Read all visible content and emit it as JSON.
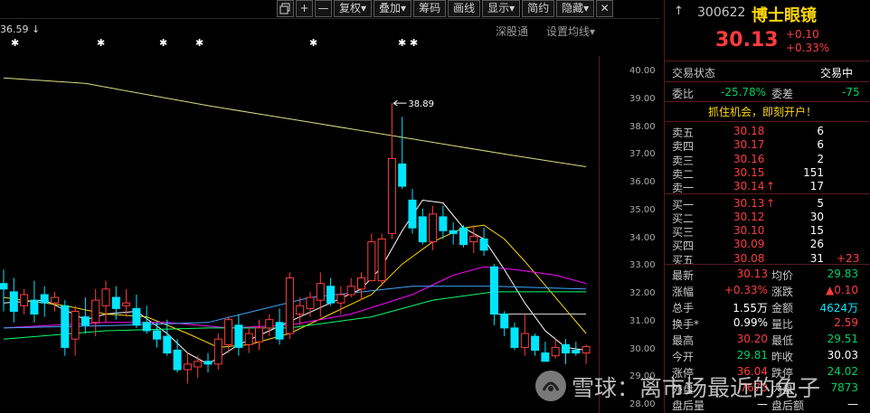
{
  "toolbar": {
    "icons": [
      "restore-icon",
      "plus-icon",
      "minus-icon"
    ],
    "buttons": [
      "复权▾",
      "叠加▾",
      "筹码",
      "画线",
      "显示▾",
      "简约",
      "隐藏▾"
    ],
    "close_icon": "✕"
  },
  "chart_header": {
    "price_hint": "36.59 ↓",
    "sector_link": "深股通",
    "ma_settings": "设置均线▾"
  },
  "chart_data": {
    "type": "candlestick",
    "y_axis_ticks": [
      "40.00",
      "39.00",
      "38.00",
      "37.00",
      "36.00",
      "35.00",
      "34.00",
      "33.00",
      "32.00",
      "31.00",
      "30.00",
      "29.00",
      "28.00"
    ],
    "ylim": [
      28,
      40
    ],
    "high_annotation": "38.89",
    "colors": {
      "up": "#ff3c3c",
      "down": "#00e5ff",
      "ma5": "#ffffff",
      "ma10": "#ffd700",
      "ma20": "#ff00ff",
      "ma60": "#00ff66",
      "ma120": "#3fa6ff",
      "ma250": "#dede80"
    },
    "candles": [
      {
        "o": 32.4,
        "h": 32.9,
        "l": 31.4,
        "c": 32.2
      },
      {
        "o": 32.1,
        "h": 32.6,
        "l": 31.0,
        "c": 31.4
      },
      {
        "o": 31.6,
        "h": 32.2,
        "l": 31.3,
        "c": 32.0
      },
      {
        "o": 31.8,
        "h": 32.5,
        "l": 31.0,
        "c": 31.3
      },
      {
        "o": 32.0,
        "h": 32.3,
        "l": 31.2,
        "c": 31.7
      },
      {
        "o": 31.7,
        "h": 32.1,
        "l": 31.4,
        "c": 31.9
      },
      {
        "o": 31.6,
        "h": 31.8,
        "l": 29.8,
        "c": 30.1
      },
      {
        "o": 30.4,
        "h": 31.6,
        "l": 29.8,
        "c": 31.4
      },
      {
        "o": 31.2,
        "h": 31.9,
        "l": 30.6,
        "c": 30.9
      },
      {
        "o": 31.0,
        "h": 32.2,
        "l": 30.5,
        "c": 31.8
      },
      {
        "o": 31.6,
        "h": 32.5,
        "l": 31.0,
        "c": 32.2
      },
      {
        "o": 31.9,
        "h": 32.3,
        "l": 31.1,
        "c": 31.5
      },
      {
        "o": 31.6,
        "h": 32.2,
        "l": 31.2,
        "c": 31.7
      },
      {
        "o": 31.5,
        "h": 32.0,
        "l": 30.8,
        "c": 30.9
      },
      {
        "o": 31.0,
        "h": 31.6,
        "l": 30.6,
        "c": 30.7
      },
      {
        "o": 30.7,
        "h": 31.0,
        "l": 30.1,
        "c": 30.4
      },
      {
        "o": 30.5,
        "h": 31.1,
        "l": 29.8,
        "c": 29.9
      },
      {
        "o": 30.0,
        "h": 30.4,
        "l": 29.2,
        "c": 29.3
      },
      {
        "o": 29.3,
        "h": 29.9,
        "l": 28.8,
        "c": 29.5
      },
      {
        "o": 29.4,
        "h": 29.8,
        "l": 29.0,
        "c": 29.6
      },
      {
        "o": 29.6,
        "h": 29.9,
        "l": 29.2,
        "c": 29.5
      },
      {
        "o": 29.5,
        "h": 30.6,
        "l": 29.3,
        "c": 30.4
      },
      {
        "o": 30.2,
        "h": 31.2,
        "l": 29.9,
        "c": 31.1
      },
      {
        "o": 30.9,
        "h": 31.3,
        "l": 29.8,
        "c": 30.1
      },
      {
        "o": 30.2,
        "h": 30.8,
        "l": 29.9,
        "c": 30.6
      },
      {
        "o": 30.3,
        "h": 31.1,
        "l": 30.0,
        "c": 30.8
      },
      {
        "o": 30.8,
        "h": 31.3,
        "l": 30.5,
        "c": 31.1
      },
      {
        "o": 31.0,
        "h": 31.5,
        "l": 30.2,
        "c": 30.4
      },
      {
        "o": 30.6,
        "h": 32.8,
        "l": 30.4,
        "c": 32.6
      },
      {
        "o": 31.3,
        "h": 31.9,
        "l": 30.9,
        "c": 31.6
      },
      {
        "o": 31.5,
        "h": 32.1,
        "l": 31.2,
        "c": 31.9
      },
      {
        "o": 31.8,
        "h": 32.8,
        "l": 31.2,
        "c": 32.4
      },
      {
        "o": 32.3,
        "h": 32.6,
        "l": 31.6,
        "c": 31.7
      },
      {
        "o": 31.7,
        "h": 32.3,
        "l": 31.3,
        "c": 32.0
      },
      {
        "o": 32.0,
        "h": 32.6,
        "l": 31.9,
        "c": 32.3
      },
      {
        "o": 32.2,
        "h": 32.8,
        "l": 31.8,
        "c": 32.6
      },
      {
        "o": 32.5,
        "h": 34.2,
        "l": 32.5,
        "c": 33.9
      },
      {
        "o": 32.5,
        "h": 34.2,
        "l": 32.3,
        "c": 34.0
      },
      {
        "o": 34.2,
        "h": 38.89,
        "l": 34.0,
        "c": 36.9
      },
      {
        "o": 36.7,
        "h": 38.4,
        "l": 35.8,
        "c": 35.9
      },
      {
        "o": 35.4,
        "h": 35.8,
        "l": 34.2,
        "c": 34.4
      },
      {
        "o": 34.8,
        "h": 35.1,
        "l": 33.8,
        "c": 33.9
      },
      {
        "o": 33.9,
        "h": 35.2,
        "l": 33.6,
        "c": 34.9
      },
      {
        "o": 34.8,
        "h": 35.2,
        "l": 34.0,
        "c": 34.3
      },
      {
        "o": 34.3,
        "h": 34.6,
        "l": 33.8,
        "c": 34.2
      },
      {
        "o": 34.4,
        "h": 34.5,
        "l": 33.7,
        "c": 33.8
      },
      {
        "o": 33.9,
        "h": 34.5,
        "l": 33.5,
        "c": 34.1
      },
      {
        "o": 34.0,
        "h": 34.4,
        "l": 33.4,
        "c": 33.6
      },
      {
        "o": 33.0,
        "h": 33.1,
        "l": 30.9,
        "c": 31.3
      },
      {
        "o": 31.3,
        "h": 31.4,
        "l": 30.5,
        "c": 30.8
      },
      {
        "o": 30.8,
        "h": 31.0,
        "l": 30.0,
        "c": 30.1
      },
      {
        "o": 30.1,
        "h": 31.3,
        "l": 29.8,
        "c": 30.6
      },
      {
        "o": 30.5,
        "h": 30.6,
        "l": 29.8,
        "c": 30.0
      },
      {
        "o": 29.9,
        "h": 30.3,
        "l": 29.6,
        "c": 29.6
      },
      {
        "o": 29.8,
        "h": 30.4,
        "l": 29.7,
        "c": 30.1
      },
      {
        "o": 30.2,
        "h": 30.4,
        "l": 29.5,
        "c": 29.9
      },
      {
        "o": 30.0,
        "h": 30.3,
        "l": 29.8,
        "c": 29.9
      },
      {
        "o": 29.9,
        "h": 30.2,
        "l": 29.5,
        "c": 30.13
      }
    ],
    "moving_averages": [
      {
        "name": "MA5",
        "values": [
          [
            0,
            31.7
          ],
          [
            4,
            31.8
          ],
          [
            8,
            31.1
          ],
          [
            10,
            31.3
          ],
          [
            13,
            31.4
          ],
          [
            16,
            30.6
          ],
          [
            18,
            29.9
          ],
          [
            20,
            29.5
          ],
          [
            23,
            30.2
          ],
          [
            26,
            30.7
          ],
          [
            29,
            31.2
          ],
          [
            32,
            31.7
          ],
          [
            35,
            32.2
          ],
          [
            37,
            33.0
          ],
          [
            39,
            34.3
          ],
          [
            41,
            35.4
          ],
          [
            43,
            35.3
          ],
          [
            45,
            34.4
          ],
          [
            47,
            34.0
          ],
          [
            49,
            32.9
          ],
          [
            51,
            31.7
          ],
          [
            53,
            30.7
          ],
          [
            55,
            30.1
          ],
          [
            57,
            30.0
          ]
        ]
      },
      {
        "name": "MA10",
        "values": [
          [
            0,
            31.9
          ],
          [
            6,
            31.6
          ],
          [
            10,
            31.3
          ],
          [
            14,
            31.2
          ],
          [
            18,
            30.6
          ],
          [
            21,
            30.1
          ],
          [
            24,
            30.2
          ],
          [
            28,
            30.6
          ],
          [
            32,
            31.3
          ],
          [
            36,
            32.0
          ],
          [
            39,
            33.1
          ],
          [
            42,
            33.9
          ],
          [
            45,
            34.4
          ],
          [
            47,
            34.5
          ],
          [
            49,
            34.0
          ],
          [
            51,
            33.2
          ],
          [
            54,
            31.9
          ],
          [
            57,
            30.6
          ]
        ]
      },
      {
        "name": "MA20",
        "values": [
          [
            0,
            30.8
          ],
          [
            10,
            31.0
          ],
          [
            16,
            31.0
          ],
          [
            22,
            30.8
          ],
          [
            28,
            30.9
          ],
          [
            34,
            31.3
          ],
          [
            40,
            32.0
          ],
          [
            44,
            32.7
          ],
          [
            47,
            33.0
          ],
          [
            50,
            32.9
          ],
          [
            54,
            32.7
          ],
          [
            57,
            32.4
          ]
        ]
      },
      {
        "name": "MA60",
        "values": [
          [
            0,
            30.4
          ],
          [
            10,
            30.7
          ],
          [
            20,
            30.8
          ],
          [
            28,
            30.8
          ],
          [
            36,
            31.2
          ],
          [
            42,
            31.8
          ],
          [
            48,
            32.1
          ],
          [
            57,
            32.1
          ]
        ]
      },
      {
        "name": "MA120",
        "values": [
          [
            0,
            30.8
          ],
          [
            12,
            30.9
          ],
          [
            20,
            31.0
          ],
          [
            30,
            31.9
          ],
          [
            40,
            32.3
          ],
          [
            48,
            32.3
          ],
          [
            57,
            32.2
          ]
        ]
      },
      {
        "name": "MA250",
        "values": [
          [
            0,
            39.8
          ],
          [
            8,
            39.6
          ],
          [
            20,
            38.8
          ],
          [
            30,
            38.2
          ],
          [
            40,
            37.6
          ],
          [
            50,
            37.0
          ],
          [
            57,
            36.6
          ]
        ]
      },
      {
        "name": "MA-ref",
        "values": [
          [
            48,
            31.3
          ],
          [
            57,
            31.3
          ]
        ]
      }
    ]
  },
  "quote": {
    "back_icon": "↑",
    "code": "300622",
    "name": "博士眼镜",
    "price": "30.13",
    "change": "+0.10",
    "change_pct": "+0.33%",
    "status_label": "交易状态",
    "status_value": "交易中",
    "weibi_label": "委比",
    "weibi_value": "-25.78%",
    "weicha_label": "委差",
    "weicha_value": "-75",
    "promo": "抓住机会，即刻开户！",
    "asks": [
      {
        "label": "卖五",
        "price": "30.18",
        "vol": "6",
        "mark": ""
      },
      {
        "label": "卖四",
        "price": "30.17",
        "vol": "6",
        "mark": ""
      },
      {
        "label": "卖三",
        "price": "30.16",
        "vol": "2",
        "mark": ""
      },
      {
        "label": "卖二",
        "price": "30.15",
        "vol": "151",
        "mark": ""
      },
      {
        "label": "卖一",
        "price": "30.14",
        "vol": "17",
        "mark": "↑"
      }
    ],
    "bids": [
      {
        "label": "买一",
        "price": "30.13",
        "vol": "5",
        "mark": "↑",
        "delta": ""
      },
      {
        "label": "买二",
        "price": "30.12",
        "vol": "30",
        "mark": "",
        "delta": ""
      },
      {
        "label": "买三",
        "price": "30.10",
        "vol": "15",
        "mark": "",
        "delta": ""
      },
      {
        "label": "买四",
        "price": "30.09",
        "vol": "26",
        "mark": "",
        "delta": ""
      },
      {
        "label": "买五",
        "price": "30.08",
        "vol": "31",
        "mark": "",
        "delta": "+23"
      }
    ],
    "stats": [
      {
        "l1": "最新",
        "v1": "30.13",
        "c1": "red",
        "l2": "均价",
        "v2": "29.83",
        "c2": "green"
      },
      {
        "l1": "涨幅",
        "v1": "+0.33%",
        "c1": "red",
        "l2": "涨跌",
        "v2": "▲0.10",
        "c2": "red"
      },
      {
        "l1": "总手",
        "v1": "1.55万",
        "c1": "white",
        "l2": "金额",
        "v2": "4624万",
        "c2": "cyan"
      },
      {
        "l1": "换手*",
        "v1": "0.99%",
        "c1": "white",
        "l2": "量比",
        "v2": "2.59",
        "c2": "red"
      },
      {
        "l1": "最高",
        "v1": "30.20",
        "c1": "red",
        "l2": "最低",
        "v2": "29.51",
        "c2": "green"
      },
      {
        "l1": "今开",
        "v1": "29.81",
        "c1": "green",
        "l2": "昨收",
        "v2": "30.03",
        "c2": "white"
      },
      {
        "l1": "涨停",
        "v1": "36.04",
        "c1": "red",
        "l2": "跌停",
        "v2": "24.02",
        "c2": "green"
      },
      {
        "l1": "外盘",
        "v1": "7673",
        "c1": "red",
        "l2": "内盘",
        "v2": "7873",
        "c2": "green"
      },
      {
        "l1": "盘后量",
        "v1": "—",
        "c1": "white",
        "l2": "盘后额",
        "v2": "—",
        "c2": "white"
      }
    ]
  },
  "watermark": {
    "text": "雪球：离市场最近的兔子"
  }
}
